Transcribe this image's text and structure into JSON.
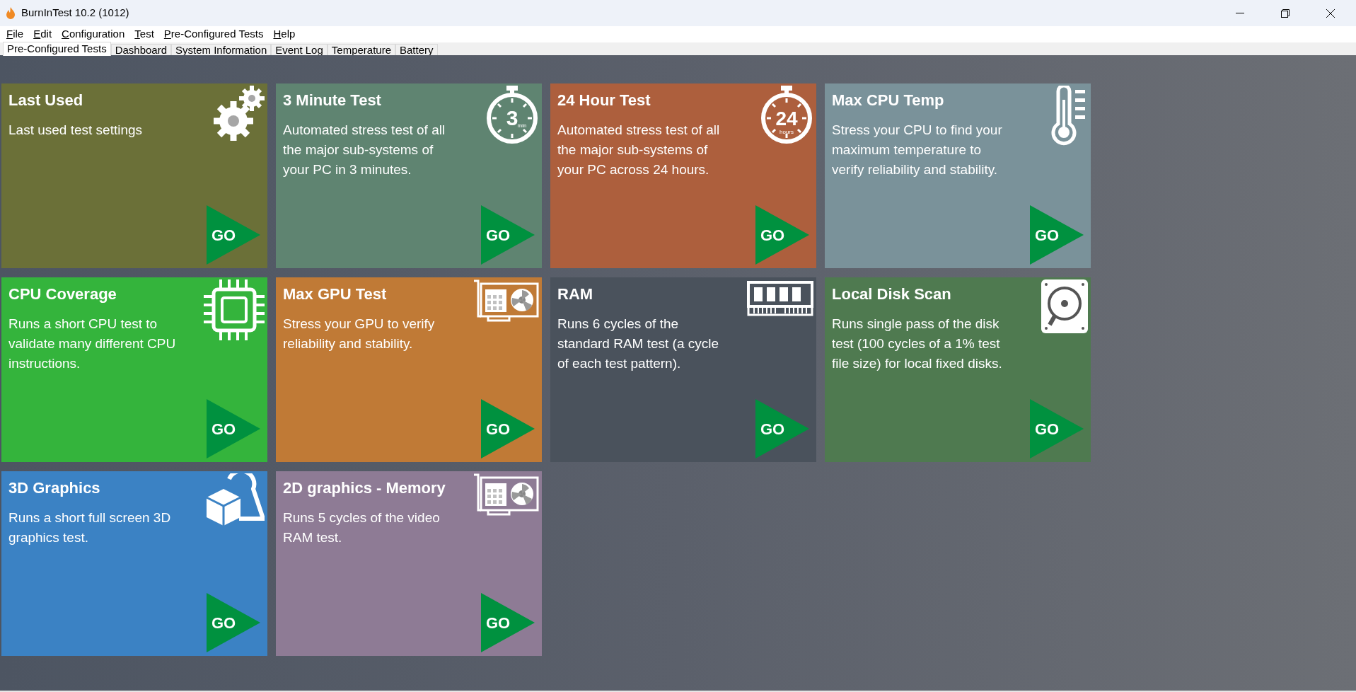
{
  "window": {
    "title": "BurnInTest 10.2 (1012)"
  },
  "menu": [
    {
      "label": "File"
    },
    {
      "label": "Edit"
    },
    {
      "label": "Configuration"
    },
    {
      "label": "Test"
    },
    {
      "label": "Pre-Configured Tests"
    },
    {
      "label": "Help"
    }
  ],
  "tabs": [
    {
      "label": "Pre-Configured Tests",
      "selected": true
    },
    {
      "label": "Dashboard",
      "selected": false
    },
    {
      "label": "System Information",
      "selected": false
    },
    {
      "label": "Event Log",
      "selected": false
    },
    {
      "label": "Temperature",
      "selected": false
    },
    {
      "label": "Battery",
      "selected": false
    }
  ],
  "tiles": [
    {
      "title": "Last Used",
      "description": "Last used test settings",
      "kind": "gears",
      "color": "#6b7038",
      "button": "GO"
    },
    {
      "title": "3 Minute Test",
      "description": "Automated stress test of all the major sub-systems of your PC in 3 minutes.",
      "kind": "timer",
      "icon_text": [
        "3",
        "min"
      ],
      "color": "#5f8471",
      "button": "GO"
    },
    {
      "title": "24 Hour Test",
      "description": "Automated stress test of all the major sub-systems of your PC across 24 hours.",
      "kind": "timer",
      "icon_text": [
        "24",
        "hours"
      ],
      "color": "#ad5f3d",
      "button": "GO"
    },
    {
      "title": "Max CPU Temp",
      "description": "Stress your CPU to find your maximum temperature to verify reliability and stability.",
      "kind": "thermometer",
      "color": "#7a929a",
      "button": "GO"
    },
    {
      "title": "CPU Coverage",
      "description": "Runs a short CPU test to validate many different CPU instructions.",
      "kind": "chip",
      "color": "#34b43c",
      "button": "GO"
    },
    {
      "title": "Max GPU Test",
      "description": "Stress your GPU to verify reliability and stability.",
      "kind": "gpu",
      "color": "#c07a36",
      "button": "GO"
    },
    {
      "title": "RAM",
      "description": "Runs 6 cycles of the standard RAM test (a cycle of each test pattern).",
      "kind": "ram",
      "color": "#4a525c",
      "button": "GO"
    },
    {
      "title": "Local Disk Scan",
      "description": "Runs single pass of the disk test (100 cycles of a 1% test file size) for local fixed disks.",
      "kind": "disk",
      "color": "#4f7a50",
      "button": "GO"
    },
    {
      "title": "3D Graphics",
      "description": "Runs a short full screen 3D graphics test.",
      "kind": "shapes",
      "color": "#3b82c4",
      "button": "GO"
    },
    {
      "title": "2D graphics - Memory",
      "description": "Runs 5 cycles of the video RAM test.",
      "kind": "gpu",
      "color": "#8e7b95",
      "button": "GO"
    }
  ]
}
